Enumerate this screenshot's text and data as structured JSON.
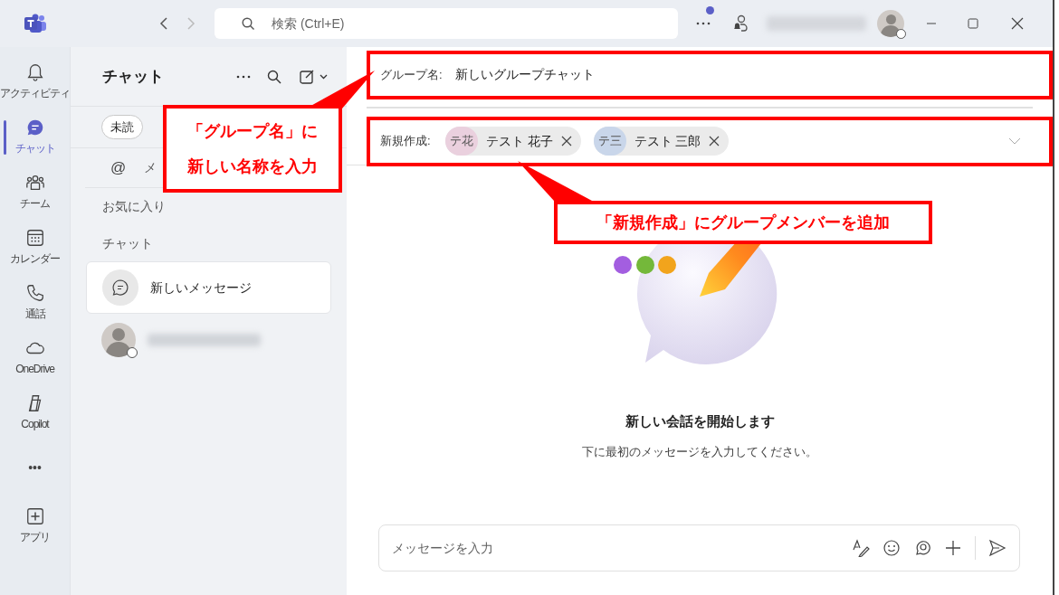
{
  "title_bar": {
    "search": {
      "placeholder": "検索 (Ctrl+E)"
    }
  },
  "rail": [
    {
      "kind": "bell",
      "label": "アクティビティ",
      "selected": false
    },
    {
      "kind": "chat",
      "label": "チャット",
      "selected": true
    },
    {
      "kind": "team",
      "label": "チーム",
      "selected": false
    },
    {
      "kind": "calendar",
      "label": "カレンダー",
      "selected": false
    },
    {
      "kind": "phone",
      "label": "通話",
      "selected": false
    },
    {
      "kind": "cloud",
      "label": "OneDrive",
      "selected": false
    },
    {
      "kind": "copilot",
      "label": "Copilot",
      "selected": false
    },
    {
      "kind": "more",
      "label": "•••",
      "selected": false
    },
    {
      "kind": "apps",
      "label": "アプリ",
      "selected": false
    }
  ],
  "chat_panel": {
    "title": "チャット",
    "filters": [
      "未読"
    ],
    "mention_icon": "@",
    "mention_row": "メ",
    "sections": [
      "お気に入り",
      "チャット"
    ],
    "items": [
      {
        "kind": "new",
        "label": "新しいメッセージ",
        "selected": true
      },
      {
        "kind": "contact",
        "selected": false
      }
    ]
  },
  "compose": {
    "group_name_label": "グループ名:",
    "group_name_value": "新しいグループチャット",
    "to_label": "新規作成:",
    "recipients": [
      {
        "initials": "テ花",
        "name": "テスト 花子",
        "color": "#ead0de"
      },
      {
        "initials": "テ三",
        "name": "テスト 三郎",
        "color": "#c9d6ea"
      }
    ]
  },
  "empty_state": {
    "title": "新しい会話を開始します",
    "subtitle": "下に最初のメッセージを入力してください。"
  },
  "message_box": {
    "placeholder": "メッセージを入力"
  },
  "callouts": [
    {
      "lines": [
        "「グループ名」に",
        "新しい名称を入力"
      ]
    },
    {
      "lines": [
        "「新規作成」にグループメンバーを追加"
      ]
    }
  ]
}
